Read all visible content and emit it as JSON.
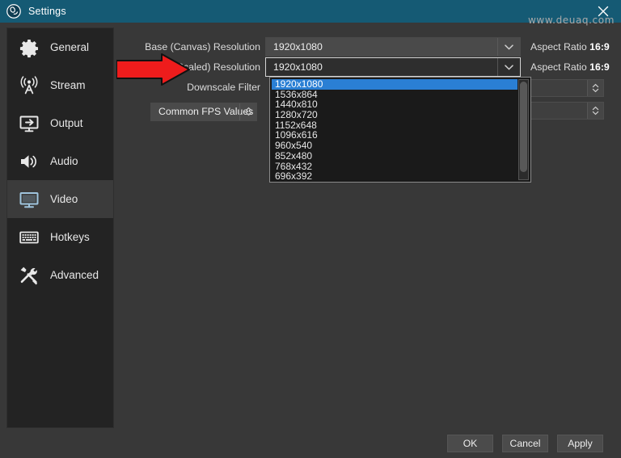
{
  "window": {
    "title": "Settings",
    "logo_icon": "obs-logo-icon",
    "close_icon": "close-icon",
    "titlebar_color": "#155a74"
  },
  "sidebar": {
    "items": [
      {
        "label": "General",
        "icon": "gear-icon",
        "selected": false
      },
      {
        "label": "Stream",
        "icon": "antenna-icon",
        "selected": false
      },
      {
        "label": "Output",
        "icon": "monitor-arrow-icon",
        "selected": false
      },
      {
        "label": "Audio",
        "icon": "speaker-icon",
        "selected": false
      },
      {
        "label": "Video",
        "icon": "monitor-icon",
        "selected": true
      },
      {
        "label": "Hotkeys",
        "icon": "keyboard-icon",
        "selected": false
      },
      {
        "label": "Advanced",
        "icon": "tools-icon",
        "selected": false
      }
    ],
    "selected_index": 4,
    "selected_accent": "#9fc4dd"
  },
  "video_settings": {
    "base_resolution": {
      "label": "Base (Canvas) Resolution",
      "value": "1920x1080",
      "aspect_label": "Aspect Ratio",
      "aspect_value": "16:9"
    },
    "output_resolution": {
      "label": "Output (Scaled) Resolution",
      "value": "1920x1080",
      "aspect_label": "Aspect Ratio",
      "aspect_value": "16:9",
      "focused": true
    },
    "downscale_filter": {
      "label": "Downscale Filter"
    },
    "common_fps_values": {
      "label": "Common FPS Values"
    }
  },
  "dropdown": {
    "open": true,
    "selected_value": "1920x1080",
    "highlight_color": "#2a7fd4",
    "options": [
      "1920x1080",
      "1536x864",
      "1440x810",
      "1280x720",
      "1152x648",
      "1096x616",
      "960x540",
      "852x480",
      "768x432",
      "696x392"
    ]
  },
  "annotation": {
    "arrow_color": "#ee1c1c",
    "arrow_name": "red-pointer-arrow",
    "points_at": "Output (Scaled) Resolution"
  },
  "footer": {
    "ok_label": "OK",
    "cancel_label": "Cancel",
    "apply_label": "Apply"
  },
  "watermark": {
    "text": "www.deuaq.com"
  }
}
